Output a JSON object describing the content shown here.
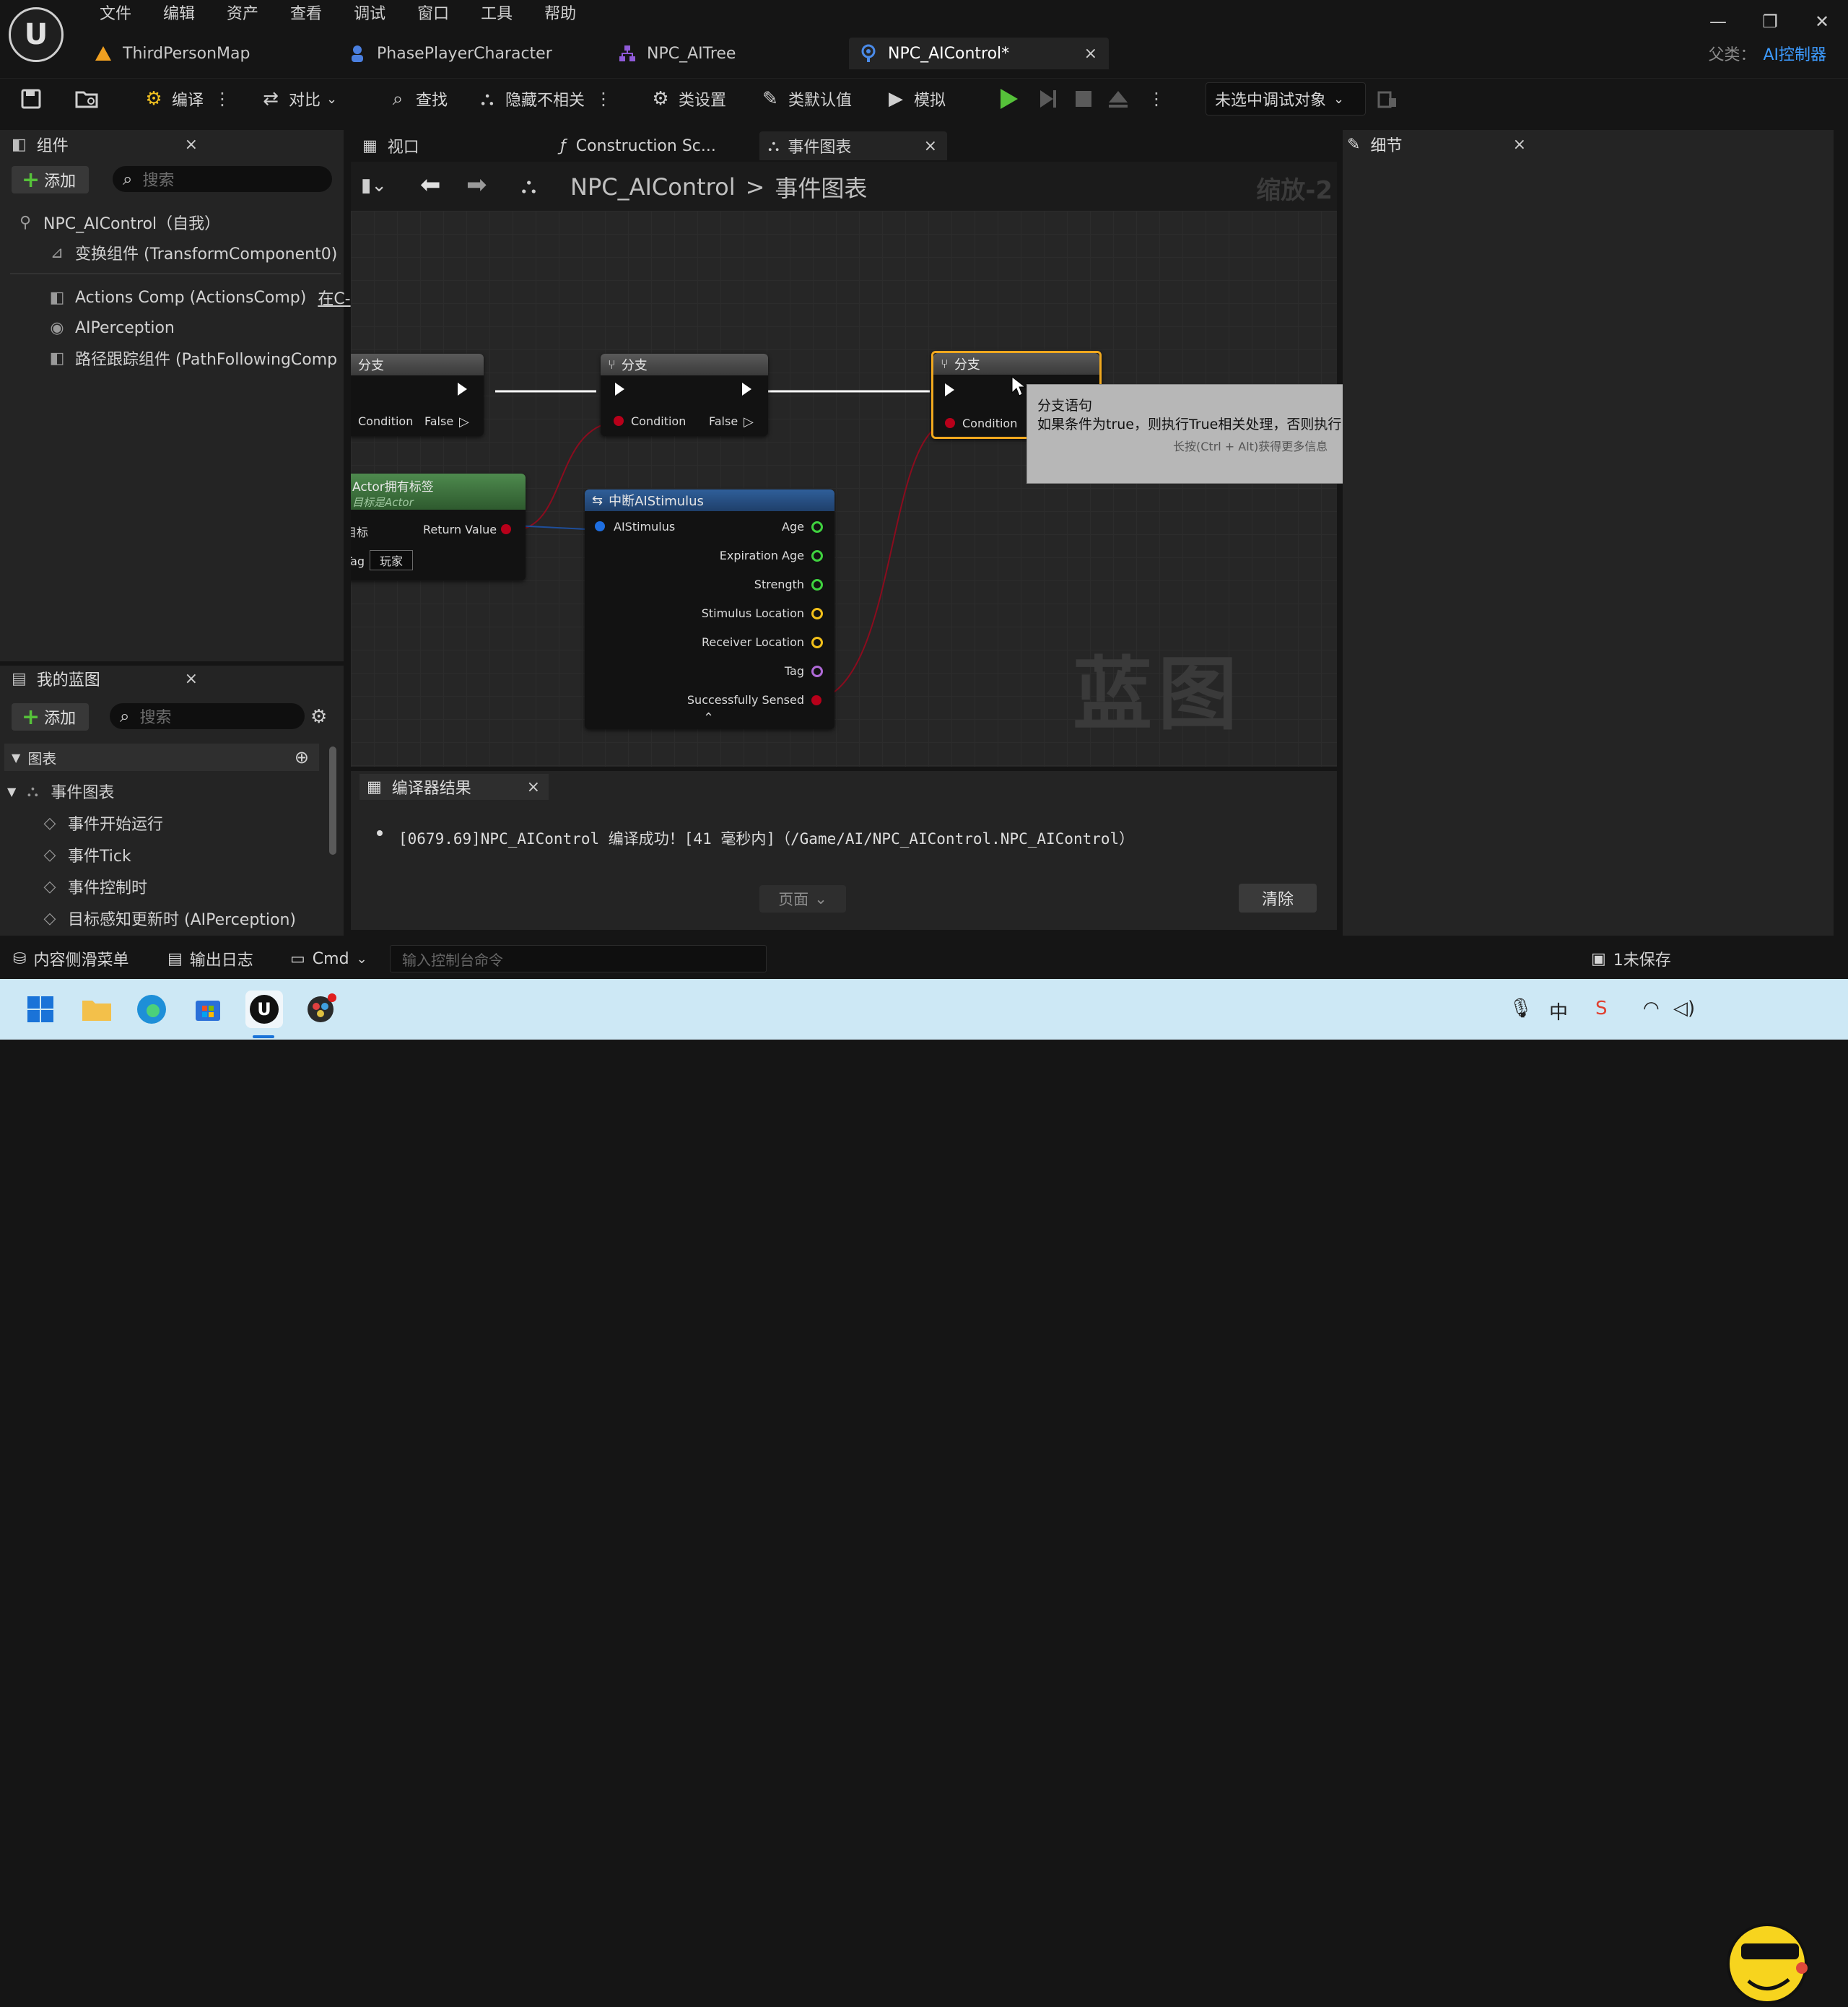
{
  "menu": [
    "文件",
    "编辑",
    "资产",
    "查看",
    "调试",
    "窗口",
    "工具",
    "帮助"
  ],
  "doc_tabs": [
    {
      "label": "ThirdPersonMap"
    },
    {
      "label": "PhasePlayerCharacter"
    },
    {
      "label": "NPC_AITree"
    },
    {
      "label": "NPC_AIControl*",
      "close": "×"
    }
  ],
  "parent_class": {
    "label": "父类：",
    "value": "AI控制器"
  },
  "toolbar": {
    "compile": "编译",
    "diff": "对比",
    "find": "查找",
    "hide_unrelated": "隐藏不相关",
    "class_settings": "类设置",
    "class_defaults": "类默认值",
    "simulate": "模拟",
    "debug_object": "未选中调试对象"
  },
  "components": {
    "title": "组件",
    "add": "添加",
    "search_placeholder": "搜索",
    "items": [
      "NPC_AIControl（自我）",
      "变换组件 (TransformComponent0)",
      "Actions Comp (ActionsComp)",
      "AIPerception",
      "路径跟踪组件 (PathFollowingComp"
    ],
    "actions_suffix": "在C-"
  },
  "graph_tabs": [
    "视口",
    "Construction Sc...",
    "事件图表"
  ],
  "breadcrumb": {
    "root": "NPC_AIControl",
    "sep": ">",
    "leaf": "事件图表"
  },
  "zoom": "缩放-2",
  "watermark": "蓝图",
  "nodes": {
    "branch_title": "分支",
    "condition": "Condition",
    "false_label": "False",
    "has_tag_title": "Actor拥有标签",
    "has_tag_subtitle": "目标是Actor",
    "has_tag_target": "目标",
    "has_tag_tag": "Tag",
    "has_tag_value": "玩家",
    "return_value": "Return Value",
    "stimulus_title": "中断AIStimulus",
    "stimulus_pins": [
      "AIStimulus"
    ],
    "stimulus_outputs": [
      "Age",
      "Expiration Age",
      "Strength",
      "Stimulus Location",
      "Receiver Location",
      "Tag",
      "Successfully Sensed"
    ]
  },
  "tooltip": {
    "title": "分支语句",
    "body": "如果条件为true，则执行True相关处理，否则执行False相关处理。",
    "hint": "长按(Ctrl + Alt)获得更多信息"
  },
  "my_blueprint": {
    "title": "我的蓝图",
    "add": "添加",
    "search_placeholder": "搜索",
    "section": "图表",
    "graph": "事件图表",
    "events": [
      "事件开始运行",
      "事件Tick",
      "事件控制时",
      "目标感知更新时 (AIPerception)"
    ]
  },
  "details": {
    "title": "细节"
  },
  "compiler": {
    "title": "编译器结果",
    "message": "[0679.69]NPC_AIControl 编译成功！[41 毫秒内]（/Game/AI/NPC_AIControl.NPC_AIControl）",
    "page": "页面",
    "clear": "清除"
  },
  "statusbar": {
    "content_drawer": "内容侧滑菜单",
    "output_log": "输出日志",
    "cmd": "Cmd",
    "console_placeholder": "输入控制台命令",
    "unsaved": "1未保存"
  },
  "taskbar": {
    "ime": "中"
  },
  "colors": {
    "accent": "#3d9bff",
    "play": "#56c23a",
    "selected_node": "#f0a81e",
    "exec_wire": "#ffffff",
    "bool_pin": "#b8001a",
    "struct_pin": "#1e6ee0",
    "vector_pin": "#f2c01a"
  }
}
